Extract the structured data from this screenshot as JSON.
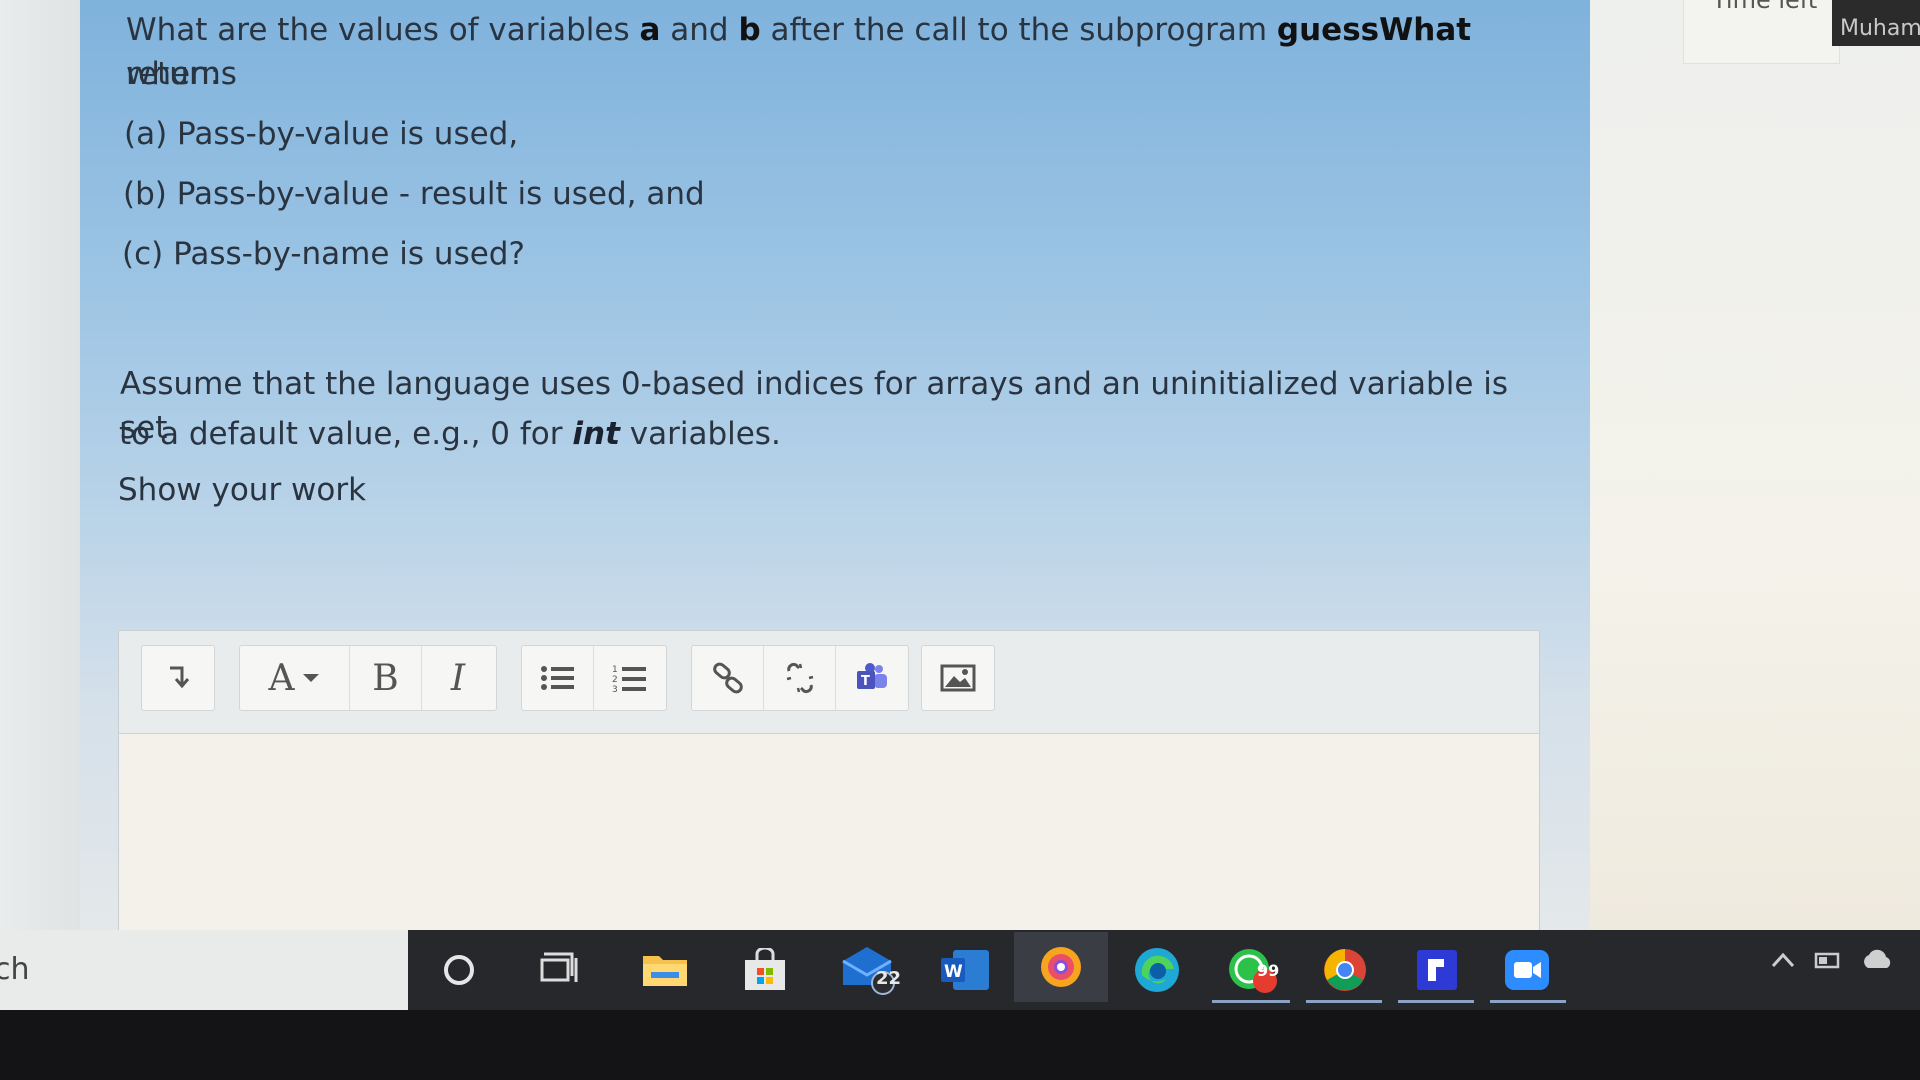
{
  "header": {
    "timer_label": "Time left",
    "user_name": "Muhammad"
  },
  "question": {
    "line1_pre": "What are the values of variables ",
    "var_a": "a",
    "and_word": " and ",
    "var_b": "b",
    "line1_mid": " after the call to the subprogram ",
    "func_name": "guessWhat",
    "line1_post": " returns",
    "line2": "when:",
    "options": [
      "(a) Pass-by-value is used,",
      "(b) Pass-by-value - result is used, and",
      "(c) Pass-by-name is used?"
    ],
    "assume_pre": "Assume that the language uses 0-based indices for arrays and an uninitialized variable is set",
    "assume_line2_pre": "to a default value, e.g., 0 for ",
    "assume_type": "int",
    "assume_line2_post": " variables.",
    "show_work": "Show your work"
  },
  "editor": {
    "toolbar_icons": [
      "expand-toolbar-icon",
      "font-color-icon",
      "bold-icon",
      "italic-icon",
      "bullet-list-icon",
      "numbered-list-icon",
      "link-icon",
      "unlink-icon",
      "teams-icon",
      "image-icon"
    ],
    "font_label": "A",
    "bold_label": "B",
    "italic_label": "I",
    "content": ""
  },
  "taskbar": {
    "search_text": "ch",
    "mail_badge": "22",
    "whatsapp_badge": "99",
    "apps": [
      "cortana",
      "task-view",
      "file-explorer",
      "store",
      "mail",
      "word",
      "browser",
      "edge",
      "whatsapp",
      "chrome",
      "app",
      "zoom"
    ]
  },
  "colors": {
    "panel_tint": "#9cc4e4",
    "taskbar": "#26282c",
    "text": "#2a3440"
  }
}
